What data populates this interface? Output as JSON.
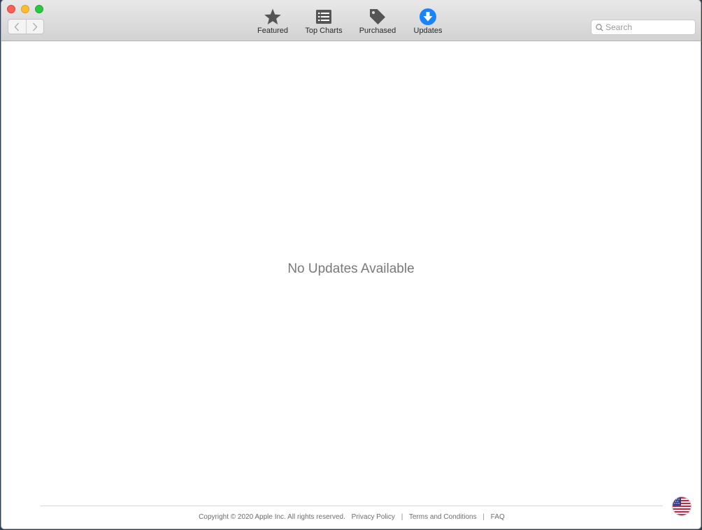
{
  "window": {
    "controls": {
      "close": "close-icon",
      "minimize": "minimize-icon",
      "zoom": "zoom-icon"
    }
  },
  "nav": {
    "back_icon": "chevron-left-icon",
    "forward_icon": "chevron-right-icon"
  },
  "toolbar": {
    "items": [
      {
        "label": "Featured",
        "icon": "star-icon",
        "selected": false
      },
      {
        "label": "Top Charts",
        "icon": "list-icon",
        "selected": false
      },
      {
        "label": "Purchased",
        "icon": "tag-icon",
        "selected": false
      },
      {
        "label": "Updates",
        "icon": "download-arrow-icon",
        "selected": true
      }
    ],
    "accent_color": "#1a82fb"
  },
  "search": {
    "placeholder": "Search",
    "value": ""
  },
  "main": {
    "empty_message": "No Updates Available"
  },
  "footer": {
    "copyright": "Copyright © 2020 Apple Inc. All rights reserved.",
    "links": [
      "Privacy Policy",
      "Terms and Conditions",
      "FAQ"
    ],
    "separator": "|",
    "store_flag_icon": "us-flag-icon"
  }
}
